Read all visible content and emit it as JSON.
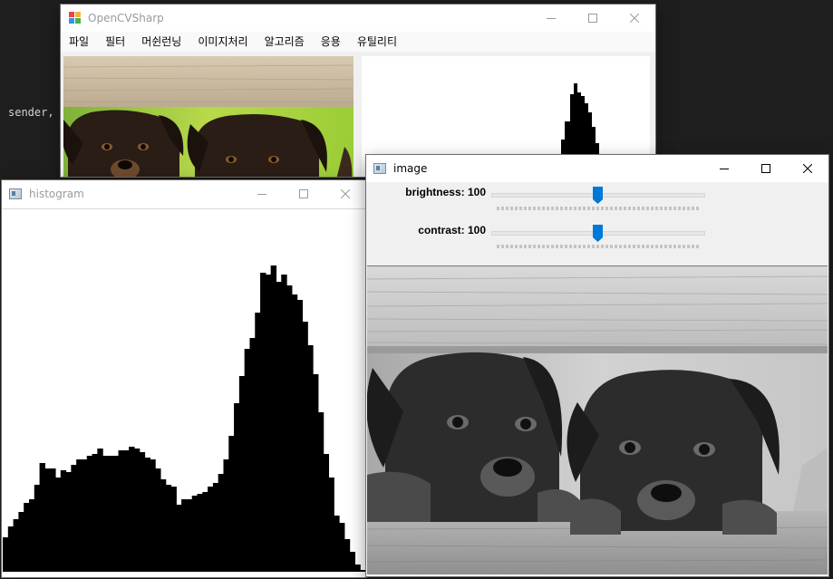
{
  "editor": {
    "code_fragment": "sender,"
  },
  "main_window": {
    "title": "OpenCVSharp",
    "menu": [
      "파일",
      "필터",
      "머쉰런닝",
      "이미지처리",
      "알고리즘",
      "응용",
      "유틸리티"
    ]
  },
  "histogram_window": {
    "title": "histogram",
    "bar_values": [
      38,
      50,
      58,
      66,
      76,
      80,
      96,
      120,
      114,
      114,
      104,
      112,
      110,
      118,
      124,
      124,
      128,
      130,
      136,
      128,
      128,
      128,
      134,
      134,
      138,
      136,
      132,
      126,
      124,
      114,
      102,
      96,
      94,
      74,
      80,
      80,
      84,
      86,
      88,
      94,
      98,
      108,
      124,
      150,
      186,
      216,
      246,
      258,
      286,
      330,
      328,
      338,
      320,
      328,
      316,
      306,
      300,
      276,
      250,
      218,
      176,
      130,
      104,
      62,
      54,
      36,
      22,
      8,
      2
    ],
    "bar_max": 344
  },
  "image_window": {
    "title": "image",
    "trackbars": [
      {
        "label": "brightness: 100",
        "value": 100,
        "max": 200
      },
      {
        "label": "contrast: 100",
        "value": 100,
        "max": 200
      }
    ]
  },
  "colors": {
    "accent": "#0078d7",
    "editor_bg": "#1e1e1e",
    "histogram_bar": "#000000"
  }
}
